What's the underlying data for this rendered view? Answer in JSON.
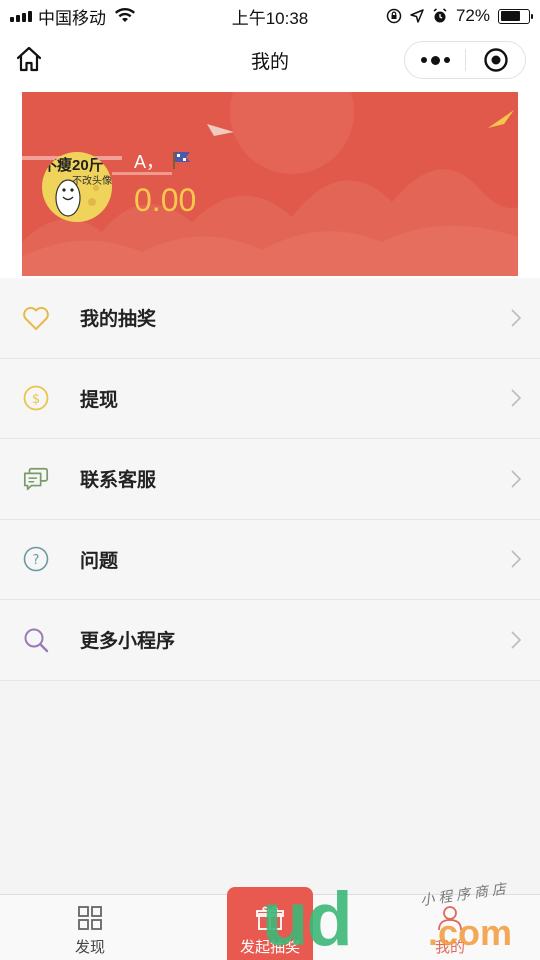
{
  "status_bar": {
    "carrier": "中国移动",
    "time": "上午10:38",
    "battery": "72%",
    "battery_level": 0.72
  },
  "nav": {
    "title": "我的"
  },
  "profile": {
    "avatar_caption": "不瘦20斤",
    "avatar_subcaption": "不改头像",
    "name": "A，",
    "balance": "0.00"
  },
  "menu": [
    {
      "label": "我的抽奖",
      "icon": "heart-icon",
      "color": "#e6b94a"
    },
    {
      "label": "提现",
      "icon": "coin-icon",
      "color": "#e6c74a"
    },
    {
      "label": "联系客服",
      "icon": "chat-icon",
      "color": "#7a9a6a"
    },
    {
      "label": "问题",
      "icon": "question-icon",
      "color": "#6a9aa0"
    },
    {
      "label": "更多小程序",
      "icon": "search-icon",
      "color": "#9a7ab8"
    }
  ],
  "tabs": [
    {
      "label": "发现",
      "icon": "grid-icon"
    },
    {
      "label": "发起抽奖",
      "icon": "gift-icon"
    },
    {
      "label": "我的",
      "icon": "user-icon"
    }
  ],
  "watermark": {
    "big": "ud",
    "com": ".com",
    "small": "小程序商店"
  },
  "colors": {
    "banner": "#e0594a",
    "balance": "#f8c84e",
    "tab_center": "#e85a4f"
  }
}
